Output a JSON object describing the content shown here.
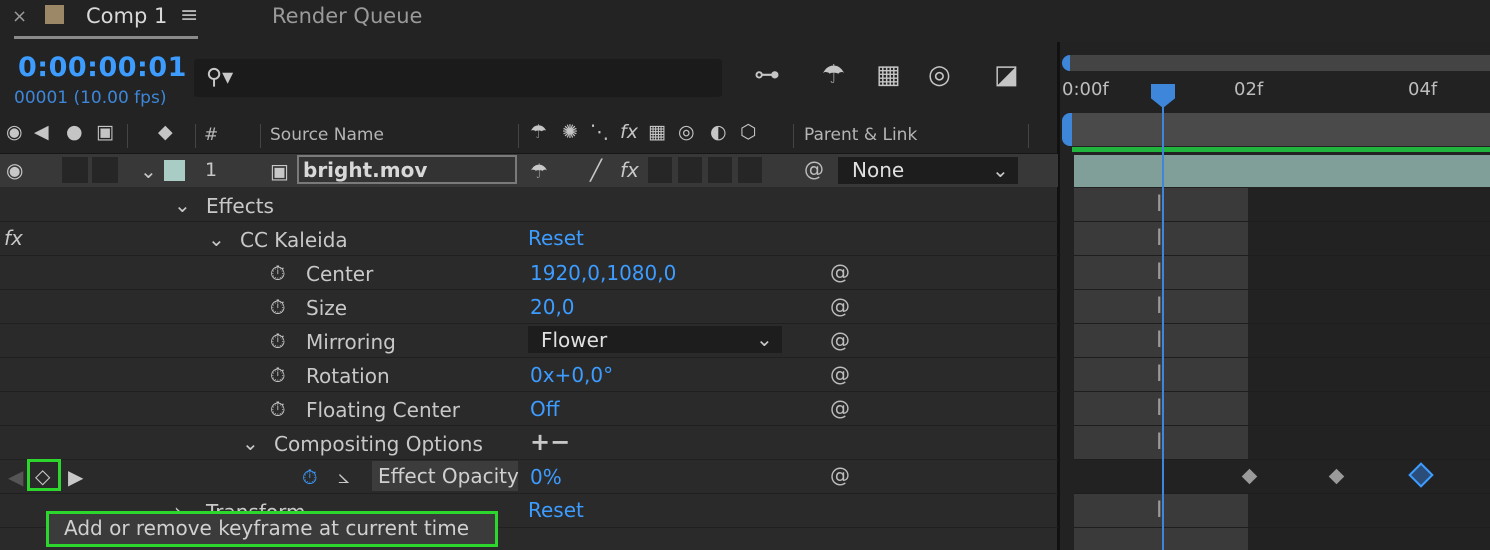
{
  "tabs": {
    "close": "×",
    "comp_title": "Comp 1",
    "menu": "≡",
    "render_queue": "Render Queue"
  },
  "time": {
    "timecode": "0:00:00:01",
    "frames": "00001 (10.00 fps)"
  },
  "search": {
    "placeholder": ""
  },
  "columns": {
    "number": "#",
    "source_name": "Source Name",
    "parent_link": "Parent & Link",
    "fx": "fx"
  },
  "layer": {
    "number": "1",
    "name": "bright.mov",
    "parent": "None",
    "fx": "fx"
  },
  "properties": {
    "effects": "Effects",
    "fx_label": "fx",
    "kaleida": "CC Kaleida",
    "kaleida_value": "Reset",
    "center": "Center",
    "center_value": "1920,0,1080,0",
    "size": "Size",
    "size_value": "20,0",
    "mirroring": "Mirroring",
    "mirroring_value": "Flower",
    "rotation": "Rotation",
    "rotation_value": "0x+0,0°",
    "floating_center": "Floating Center",
    "floating_center_value": "Off",
    "compositing": "Compositing Options",
    "compositing_value": "+−",
    "effect_opacity": "Effect Opacity",
    "effect_opacity_value": "0%",
    "transform": "Transform",
    "transform_value": "Reset"
  },
  "tooltip": "Add or remove keyframe at current time",
  "ruler": {
    "t0": "0:00f",
    "t2": "02f",
    "t4": "04f"
  },
  "colors": {
    "accent_blue": "#3d9cff",
    "highlight_green": "#2dd62d",
    "layer_label": "#a9cdc5",
    "comp_swatch": "#9c8766"
  }
}
